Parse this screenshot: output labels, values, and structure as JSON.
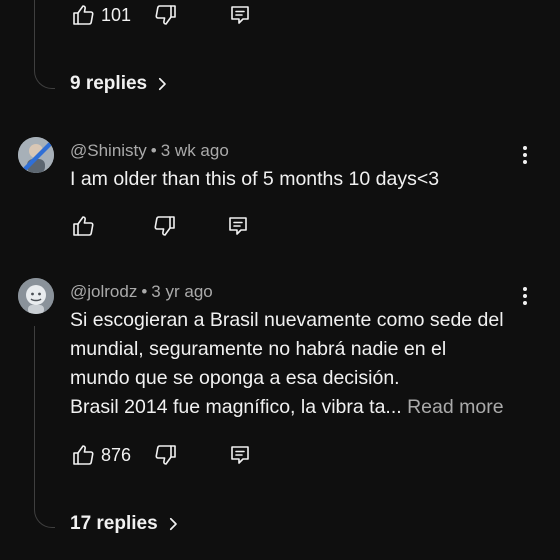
{
  "top_comment": {
    "like_count": "101",
    "replies_label": "9 replies"
  },
  "comments": [
    {
      "author": "@Shinisty",
      "separator": "•",
      "time": "3 wk ago",
      "lines": [
        "I am older than this of 5 months 10 days<3"
      ],
      "like_count": ""
    },
    {
      "author": "@jolrodz",
      "separator": "•",
      "time": "3 yr ago",
      "lines": [
        "Si escogieran a Brasil nuevamente como sede del",
        "mundial, seguramente no habrá nadie en el",
        "mundo que se oponga a esa decisión.",
        "Brasil 2014 fue magnífico, la vibra ta..."
      ],
      "read_more": "Read more",
      "like_count": "876",
      "replies_label": "17 replies"
    }
  ],
  "icons": {
    "like": "thumb-up-icon",
    "dislike": "thumb-down-icon",
    "reply": "comment-reply-icon",
    "more": "vertical-dots-icon",
    "chevron": "chevron-right-icon"
  },
  "colors": {
    "background": "#0f0f0f",
    "text_primary": "#f1f1f1",
    "text_secondary": "#aaaaaa",
    "thread_line": "#3f3f3f"
  }
}
